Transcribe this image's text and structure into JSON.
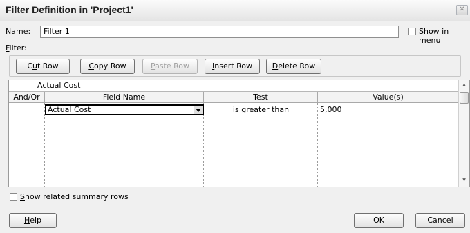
{
  "window": {
    "title": "Filter Definition in 'Project1'",
    "close_glyph": "✕",
    "close_icon": "close-icon"
  },
  "name_field": {
    "label": "Name:",
    "value": "Filter 1"
  },
  "show_in_menu": {
    "label": "Show in menu",
    "checked": false
  },
  "filter_label": "Filter:",
  "toolbar": {
    "cut_row": "Cut Row",
    "copy_row": "Copy Row",
    "paste_row": "Paste Row",
    "insert_row": "Insert Row",
    "delete_row": "Delete Row"
  },
  "grid": {
    "edit_value": "Actual Cost",
    "columns": [
      "And/Or",
      "Field Name",
      "Test",
      "Value(s)"
    ],
    "rows": [
      {
        "and_or": "",
        "field_name": "Actual Cost",
        "test": "is greater than",
        "value": "5,000"
      }
    ],
    "scroll_up_glyph": "▲",
    "scroll_down_glyph": "▼"
  },
  "show_summary_rows": {
    "label": "Show related summary rows",
    "checked": false
  },
  "buttons": {
    "help": "Help",
    "ok": "OK",
    "cancel": "Cancel"
  }
}
